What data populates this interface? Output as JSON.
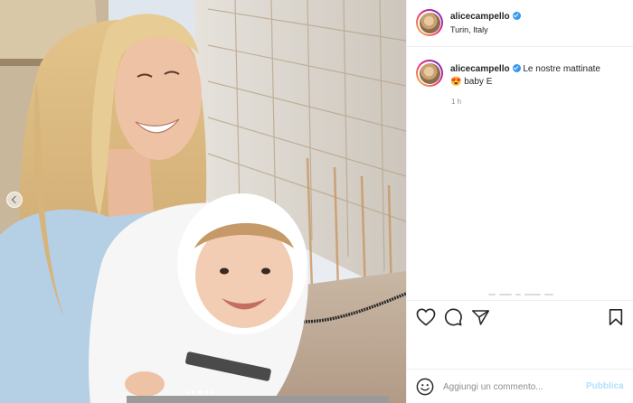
{
  "post": {
    "username": "alicecampello",
    "verified": true,
    "location": "Turin, Italy",
    "caption_text": "Le nostre mattinate",
    "caption_emoji": "😍",
    "caption_text_2": "baby E",
    "time": "1 h"
  },
  "carousel": {
    "slide_count": 5,
    "active_index": 2
  },
  "actions": {
    "icons": [
      "heart-icon",
      "comment-icon",
      "share-icon",
      "bookmark-icon"
    ]
  },
  "comment_box": {
    "placeholder": "Aggiungi un commento...",
    "value": "",
    "publish_label": "Pubblica"
  },
  "colors": {
    "verified": "#3897f0",
    "publish_disabled": "#b2dffc",
    "border": "#efefef",
    "secondary_text": "#8e8e8e"
  }
}
